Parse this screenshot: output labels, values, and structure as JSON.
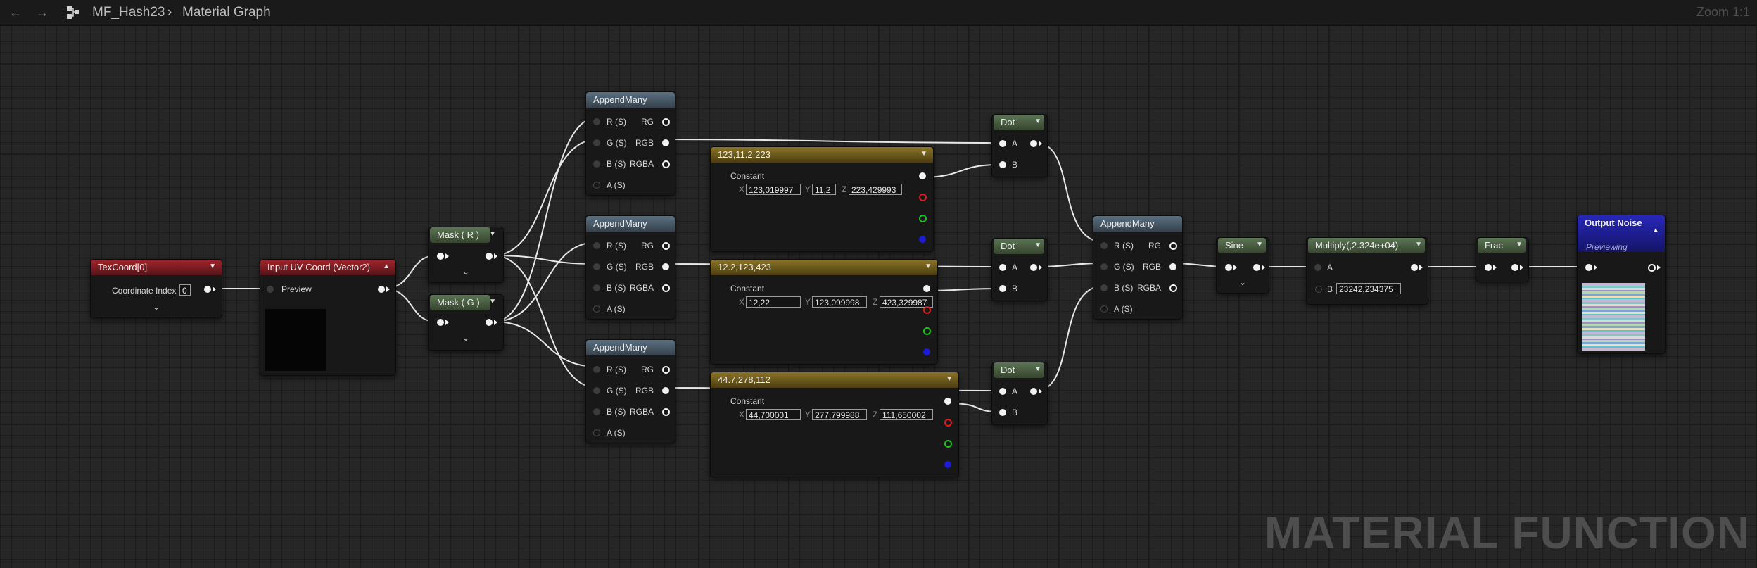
{
  "topbar": {
    "back_icon": "back-arrow-icon",
    "forward_icon": "forward-arrow-icon",
    "breadcrumb_icon": "material-function-icon",
    "breadcrumb": [
      "MF_Hash23",
      "Material Graph"
    ],
    "zoom": "Zoom 1:1"
  },
  "watermark": "MATERIAL FUNCTION",
  "nodes": {
    "texcoord": {
      "title": "TexCoord[0]",
      "prop_label": "Coordinate Index",
      "prop_value": "0"
    },
    "input_uv": {
      "title": "Input UV Coord (Vector2)",
      "pin_label": "Preview"
    },
    "mask_r": {
      "title": "Mask ( R )"
    },
    "mask_g": {
      "title": "Mask ( G )"
    },
    "append": {
      "title": "AppendMany",
      "in_pins": [
        "R (S)",
        "G (S)",
        "B (S)",
        "A (S)"
      ],
      "out_pins": [
        "RG",
        "RGB",
        "RGBA"
      ]
    },
    "const1": {
      "title": "123,11.2,223",
      "label": "Constant",
      "x": "123,019997",
      "y": "11,2",
      "z": "223,429993"
    },
    "const2": {
      "title": "12.2,123,423",
      "label": "Constant",
      "x": "12,22",
      "y": "123,099998",
      "z": "423,329987"
    },
    "const3": {
      "title": "44.7,278,112",
      "label": "Constant",
      "x": "44,700001",
      "y": "277,799988",
      "z": "111,650002"
    },
    "dot": {
      "title": "Dot",
      "a": "A",
      "b": "B"
    },
    "sine": {
      "title": "Sine"
    },
    "multiply": {
      "title": "Multiply(,2.324e+04)",
      "a": "A",
      "b": "B",
      "b_value": "23242,234375"
    },
    "frac": {
      "title": "Frac"
    },
    "output": {
      "title": "Output Noise",
      "subtitle": "Previewing"
    }
  },
  "axis": {
    "x": "X",
    "y": "Y",
    "z": "Z"
  },
  "colors": {
    "canvas": "#262626",
    "header_append": "#4f6474",
    "header_math": "#4e6648",
    "header_constant": "#7c6826",
    "header_texcoord": "#9a2228",
    "header_output": "#2424b0"
  }
}
